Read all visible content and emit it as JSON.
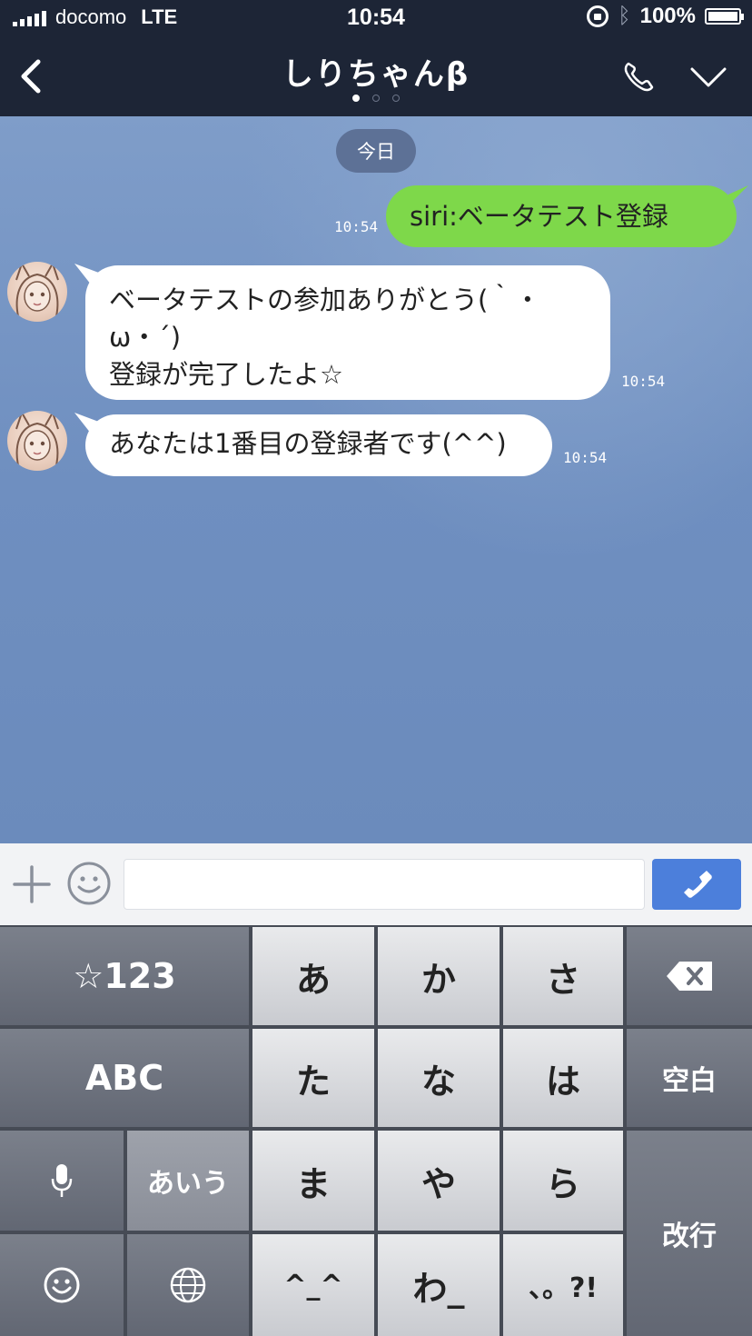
{
  "status_bar": {
    "carrier": "docomo",
    "network": "LTE",
    "time": "10:54",
    "battery_percent": "100%",
    "battery_level": 1.0
  },
  "nav": {
    "title": "しりちゃんβ",
    "page_count": 3,
    "active_page": 1
  },
  "chat": {
    "date_divider": "今日",
    "messages": [
      {
        "sender": "me",
        "lines": [
          "siri:ベータテスト登録"
        ],
        "time": "10:54"
      },
      {
        "sender": "them",
        "lines": [
          "ベータテストの参加ありがとう(｀・",
          "ω・´)",
          "登録が完了したよ☆"
        ],
        "time": "10:54"
      },
      {
        "sender": "them",
        "lines": [
          "あなたは1番目の登録者です(^^)"
        ],
        "time": "10:54"
      }
    ]
  },
  "input": {
    "placeholder": ""
  },
  "keyboard": {
    "symbols": "☆123",
    "abc": "ABC",
    "kana": "あいう",
    "keys": [
      "あ",
      "か",
      "さ",
      "た",
      "な",
      "は",
      "ま",
      "や",
      "ら",
      "^_^",
      "わ_",
      "、。?!"
    ],
    "space": "空白",
    "return": "改行"
  },
  "colors": {
    "bar": "#1d2536",
    "my_bubble": "#7ed84a",
    "their_bubble": "#ffffff",
    "call_button": "#4c7fdb"
  }
}
